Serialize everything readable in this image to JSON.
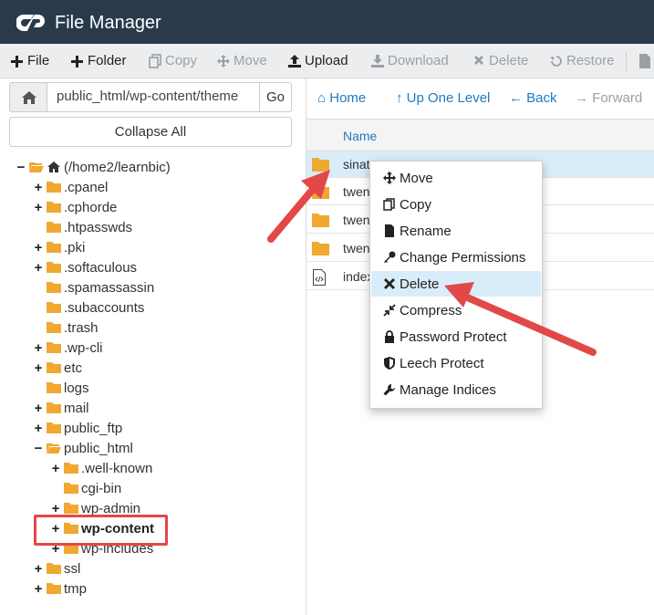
{
  "app": {
    "title": "File Manager",
    "logo_icon": "cpanel-logo"
  },
  "toolbar": [
    {
      "label": "File",
      "icon": "plus-icon",
      "enabled": true
    },
    {
      "label": "Folder",
      "icon": "plus-icon",
      "enabled": true
    },
    {
      "label": "Copy",
      "icon": "copy-icon",
      "enabled": false
    },
    {
      "label": "Move",
      "icon": "move-icon",
      "enabled": false
    },
    {
      "label": "Upload",
      "icon": "upload-icon",
      "enabled": true
    },
    {
      "label": "Download",
      "icon": "download-icon",
      "enabled": false
    },
    {
      "label": "Delete",
      "icon": "delete-icon",
      "enabled": false
    },
    {
      "label": "Restore",
      "icon": "restore-icon",
      "enabled": false
    }
  ],
  "path": {
    "value": "public_html/wp-content/theme",
    "go_label": "Go"
  },
  "collapse_label": "Collapse All",
  "tree": [
    {
      "label": "(/home2/learnbic)",
      "toggle": "−",
      "icon": "home-icon"
    },
    {
      "label": ".cpanel",
      "toggle": "+"
    },
    {
      "label": ".cphorde",
      "toggle": "+"
    },
    {
      "label": ".htpasswds",
      "toggle": ""
    },
    {
      "label": ".pki",
      "toggle": "+"
    },
    {
      "label": ".softaculous",
      "toggle": "+"
    },
    {
      "label": ".spamassassin",
      "toggle": ""
    },
    {
      "label": ".subaccounts",
      "toggle": ""
    },
    {
      "label": ".trash",
      "toggle": ""
    },
    {
      "label": ".wp-cli",
      "toggle": "+"
    },
    {
      "label": "etc",
      "toggle": "+"
    },
    {
      "label": "logs",
      "toggle": ""
    },
    {
      "label": "mail",
      "toggle": "+"
    },
    {
      "label": "public_ftp",
      "toggle": "+"
    },
    {
      "label": "public_html",
      "toggle": "−"
    },
    {
      "label": ".well-known",
      "toggle": "+"
    },
    {
      "label": "cgi-bin",
      "toggle": ""
    },
    {
      "label": "wp-admin",
      "toggle": "+"
    },
    {
      "label": "wp-content",
      "toggle": "+",
      "bold": true
    },
    {
      "label": "wp-includes",
      "toggle": "+"
    },
    {
      "label": "ssl",
      "toggle": "+"
    },
    {
      "label": "tmp",
      "toggle": "+"
    }
  ],
  "nav": [
    {
      "label": "Home",
      "icon": "home-icon",
      "enabled": true
    },
    {
      "label": "Up One Level",
      "icon": "arrow-up-icon",
      "enabled": true
    },
    {
      "label": "Back",
      "icon": "arrow-left-icon",
      "enabled": true
    },
    {
      "label": "Forward",
      "icon": "arrow-right-icon",
      "enabled": false
    }
  ],
  "table": {
    "header_name": "Name",
    "rows": [
      {
        "name": "sinat",
        "type": "folder",
        "selected": true
      },
      {
        "name": "twen",
        "type": "folder"
      },
      {
        "name": "twen",
        "type": "folder"
      },
      {
        "name": "twen",
        "type": "folder"
      },
      {
        "name": "index",
        "type": "php-file"
      }
    ]
  },
  "context_menu": [
    {
      "label": "Move",
      "icon": "move-icon"
    },
    {
      "label": "Copy",
      "icon": "copy-icon"
    },
    {
      "label": "Rename",
      "icon": "file-icon"
    },
    {
      "label": "Change Permissions",
      "icon": "key-icon"
    },
    {
      "label": "Delete",
      "icon": "delete-icon",
      "highlighted": true
    },
    {
      "label": "Compress",
      "icon": "compress-icon"
    },
    {
      "label": "Password Protect",
      "icon": "lock-icon"
    },
    {
      "label": "Leech Protect",
      "icon": "shield-icon"
    },
    {
      "label": "Manage Indices",
      "icon": "wrench-icon"
    }
  ],
  "colors": {
    "header_bg": "#293a4a",
    "link_blue": "#1f7ac0",
    "folder": "#f0a830",
    "annotation_red": "#e24848",
    "selection": "#d9ecf9"
  }
}
